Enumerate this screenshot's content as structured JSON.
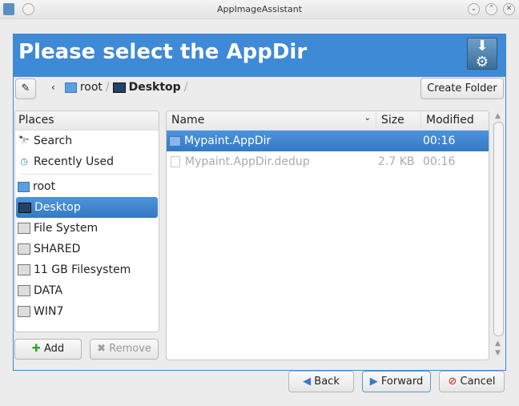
{
  "window": {
    "title": "AppImageAssistant"
  },
  "banner": {
    "heading": "Please select the AppDir"
  },
  "path": {
    "segments": [
      "root",
      "Desktop"
    ],
    "separator": "/"
  },
  "toolbar": {
    "create_folder": "Create Folder"
  },
  "places": {
    "header": "Places",
    "items": [
      {
        "label": "Search",
        "icon": "binoculars-icon"
      },
      {
        "label": "Recently Used",
        "icon": "recent-icon"
      },
      {
        "label": "root",
        "icon": "home-folder-icon"
      },
      {
        "label": "Desktop",
        "icon": "desktop-icon",
        "selected": true
      },
      {
        "label": "File System",
        "icon": "drive-icon"
      },
      {
        "label": "SHARED",
        "icon": "drive-icon"
      },
      {
        "label": "11 GB Filesystem",
        "icon": "drive-icon"
      },
      {
        "label": "DATA",
        "icon": "drive-icon"
      },
      {
        "label": "WIN7",
        "icon": "drive-icon"
      }
    ],
    "add": "Add",
    "remove": "Remove"
  },
  "files": {
    "columns": [
      "Name",
      "Size",
      "Modified"
    ],
    "rows": [
      {
        "name": "Mypaint.AppDir",
        "size": "",
        "modified": "00:16",
        "selected": true
      },
      {
        "name": "Mypaint.AppDir.dedup",
        "size": "2.7 KB",
        "modified": "00:16"
      }
    ]
  },
  "buttons": {
    "back": "Back",
    "forward": "Forward",
    "cancel": "Cancel"
  },
  "colors": {
    "accent": "#3e8ad6"
  }
}
